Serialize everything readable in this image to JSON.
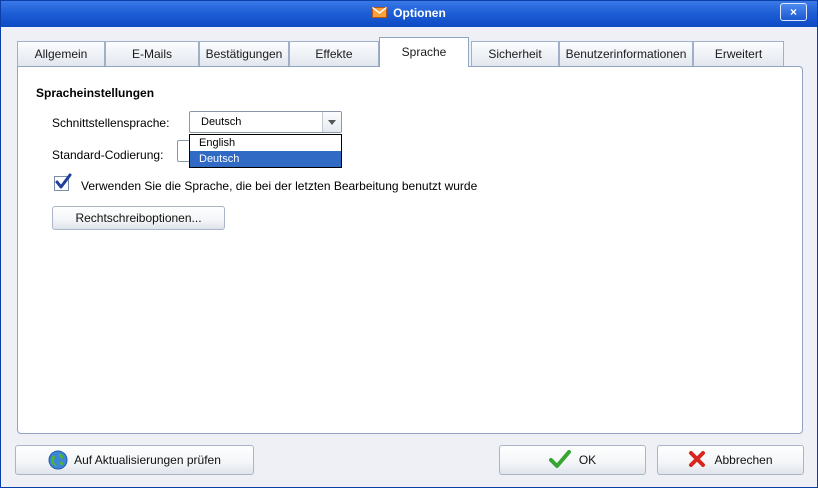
{
  "window": {
    "title": "Optionen",
    "title_icon": "envelope-icon",
    "close_icon": "close-icon",
    "close_glyph": "×"
  },
  "tabs": [
    {
      "label": "Allgemein",
      "active": false
    },
    {
      "label": "E-Mails",
      "active": false
    },
    {
      "label": "Bestätigungen",
      "active": false
    },
    {
      "label": "Effekte",
      "active": false
    },
    {
      "label": "Sprache",
      "active": true
    },
    {
      "label": "Sicherheit",
      "active": false
    },
    {
      "label": "Benutzerinformationen",
      "active": false
    },
    {
      "label": "Erweitert",
      "active": false
    }
  ],
  "language": {
    "section_title": "Spracheinstellungen",
    "interface_label": "Schnittstellensprache:",
    "interface_value": "Deutsch",
    "encoding_label": "Standard-Codierung:",
    "encoding_value": "",
    "dropdown_options": [
      {
        "label": "English",
        "selected": false
      },
      {
        "label": "Deutsch",
        "selected": true
      }
    ],
    "use_last_language_checked": true,
    "use_last_language_label": "Verwenden Sie die Sprache, die bei der letzten Bearbeitung benutzt wurde",
    "spelling_button": "Rechtschreiboptionen..."
  },
  "footer": {
    "update_button": "Auf Aktualisierungen prüfen",
    "update_icon": "globe-icon",
    "ok_button": "OK",
    "ok_icon": "checkmark-icon",
    "cancel_button": "Abbrechen",
    "cancel_icon": "x-icon"
  },
  "colors": {
    "titlebar": "#1e5fd6",
    "selection": "#316ac5",
    "ok_green": "#36a531",
    "cancel_red": "#d8261f"
  }
}
